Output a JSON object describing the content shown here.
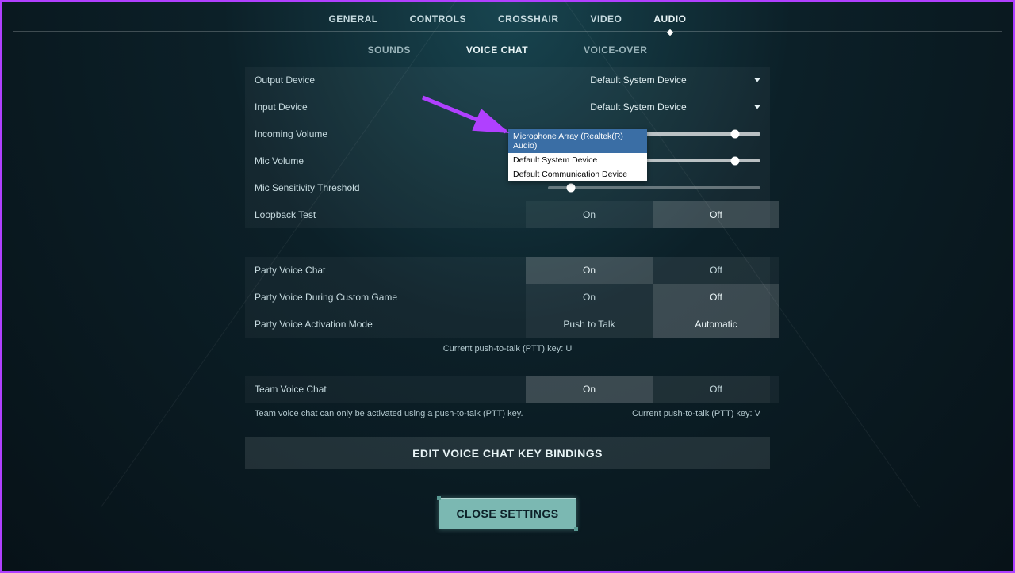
{
  "top_tabs": [
    "GENERAL",
    "CONTROLS",
    "CROSSHAIR",
    "VIDEO",
    "AUDIO"
  ],
  "top_active": "AUDIO",
  "sub_tabs": [
    "SOUNDS",
    "VOICE CHAT",
    "VOICE-OVER"
  ],
  "sub_active": "VOICE CHAT",
  "rows": {
    "output_device": {
      "label": "Output Device",
      "value": "Default System Device"
    },
    "input_device": {
      "label": "Input Device",
      "value": "Default System Device"
    },
    "incoming_volume": {
      "label": "Incoming Volume",
      "pct": 88
    },
    "mic_volume": {
      "label": "Mic Volume",
      "pct": 88
    },
    "mic_sens": {
      "label": "Mic Sensitivity Threshold",
      "pct": 11
    },
    "loopback": {
      "label": "Loopback Test",
      "options": [
        "On",
        "Off"
      ],
      "active": "Off"
    },
    "party_vc": {
      "label": "Party Voice Chat",
      "options": [
        "On",
        "Off"
      ],
      "active": "On"
    },
    "party_custom": {
      "label": "Party Voice During Custom Game",
      "options": [
        "On",
        "Off"
      ],
      "active": "Off"
    },
    "party_mode": {
      "label": "Party Voice Activation Mode",
      "options": [
        "Push to Talk",
        "Automatic"
      ],
      "active": "Automatic"
    },
    "team_vc": {
      "label": "Team Voice Chat",
      "options": [
        "On",
        "Off"
      ],
      "active": "On"
    }
  },
  "hints": {
    "party_ptt": "Current push-to-talk (PTT) key: U",
    "team_note": "Team voice chat can only be activated using a push-to-talk (PTT) key.",
    "team_ptt": "Current push-to-talk (PTT) key: V"
  },
  "buttons": {
    "bindings": "EDIT VOICE CHAT KEY BINDINGS",
    "close": "CLOSE SETTINGS"
  },
  "dropdown_options": [
    "Microphone Array (Realtek(R) Audio)",
    "Default System Device",
    "Default Communication Device"
  ]
}
